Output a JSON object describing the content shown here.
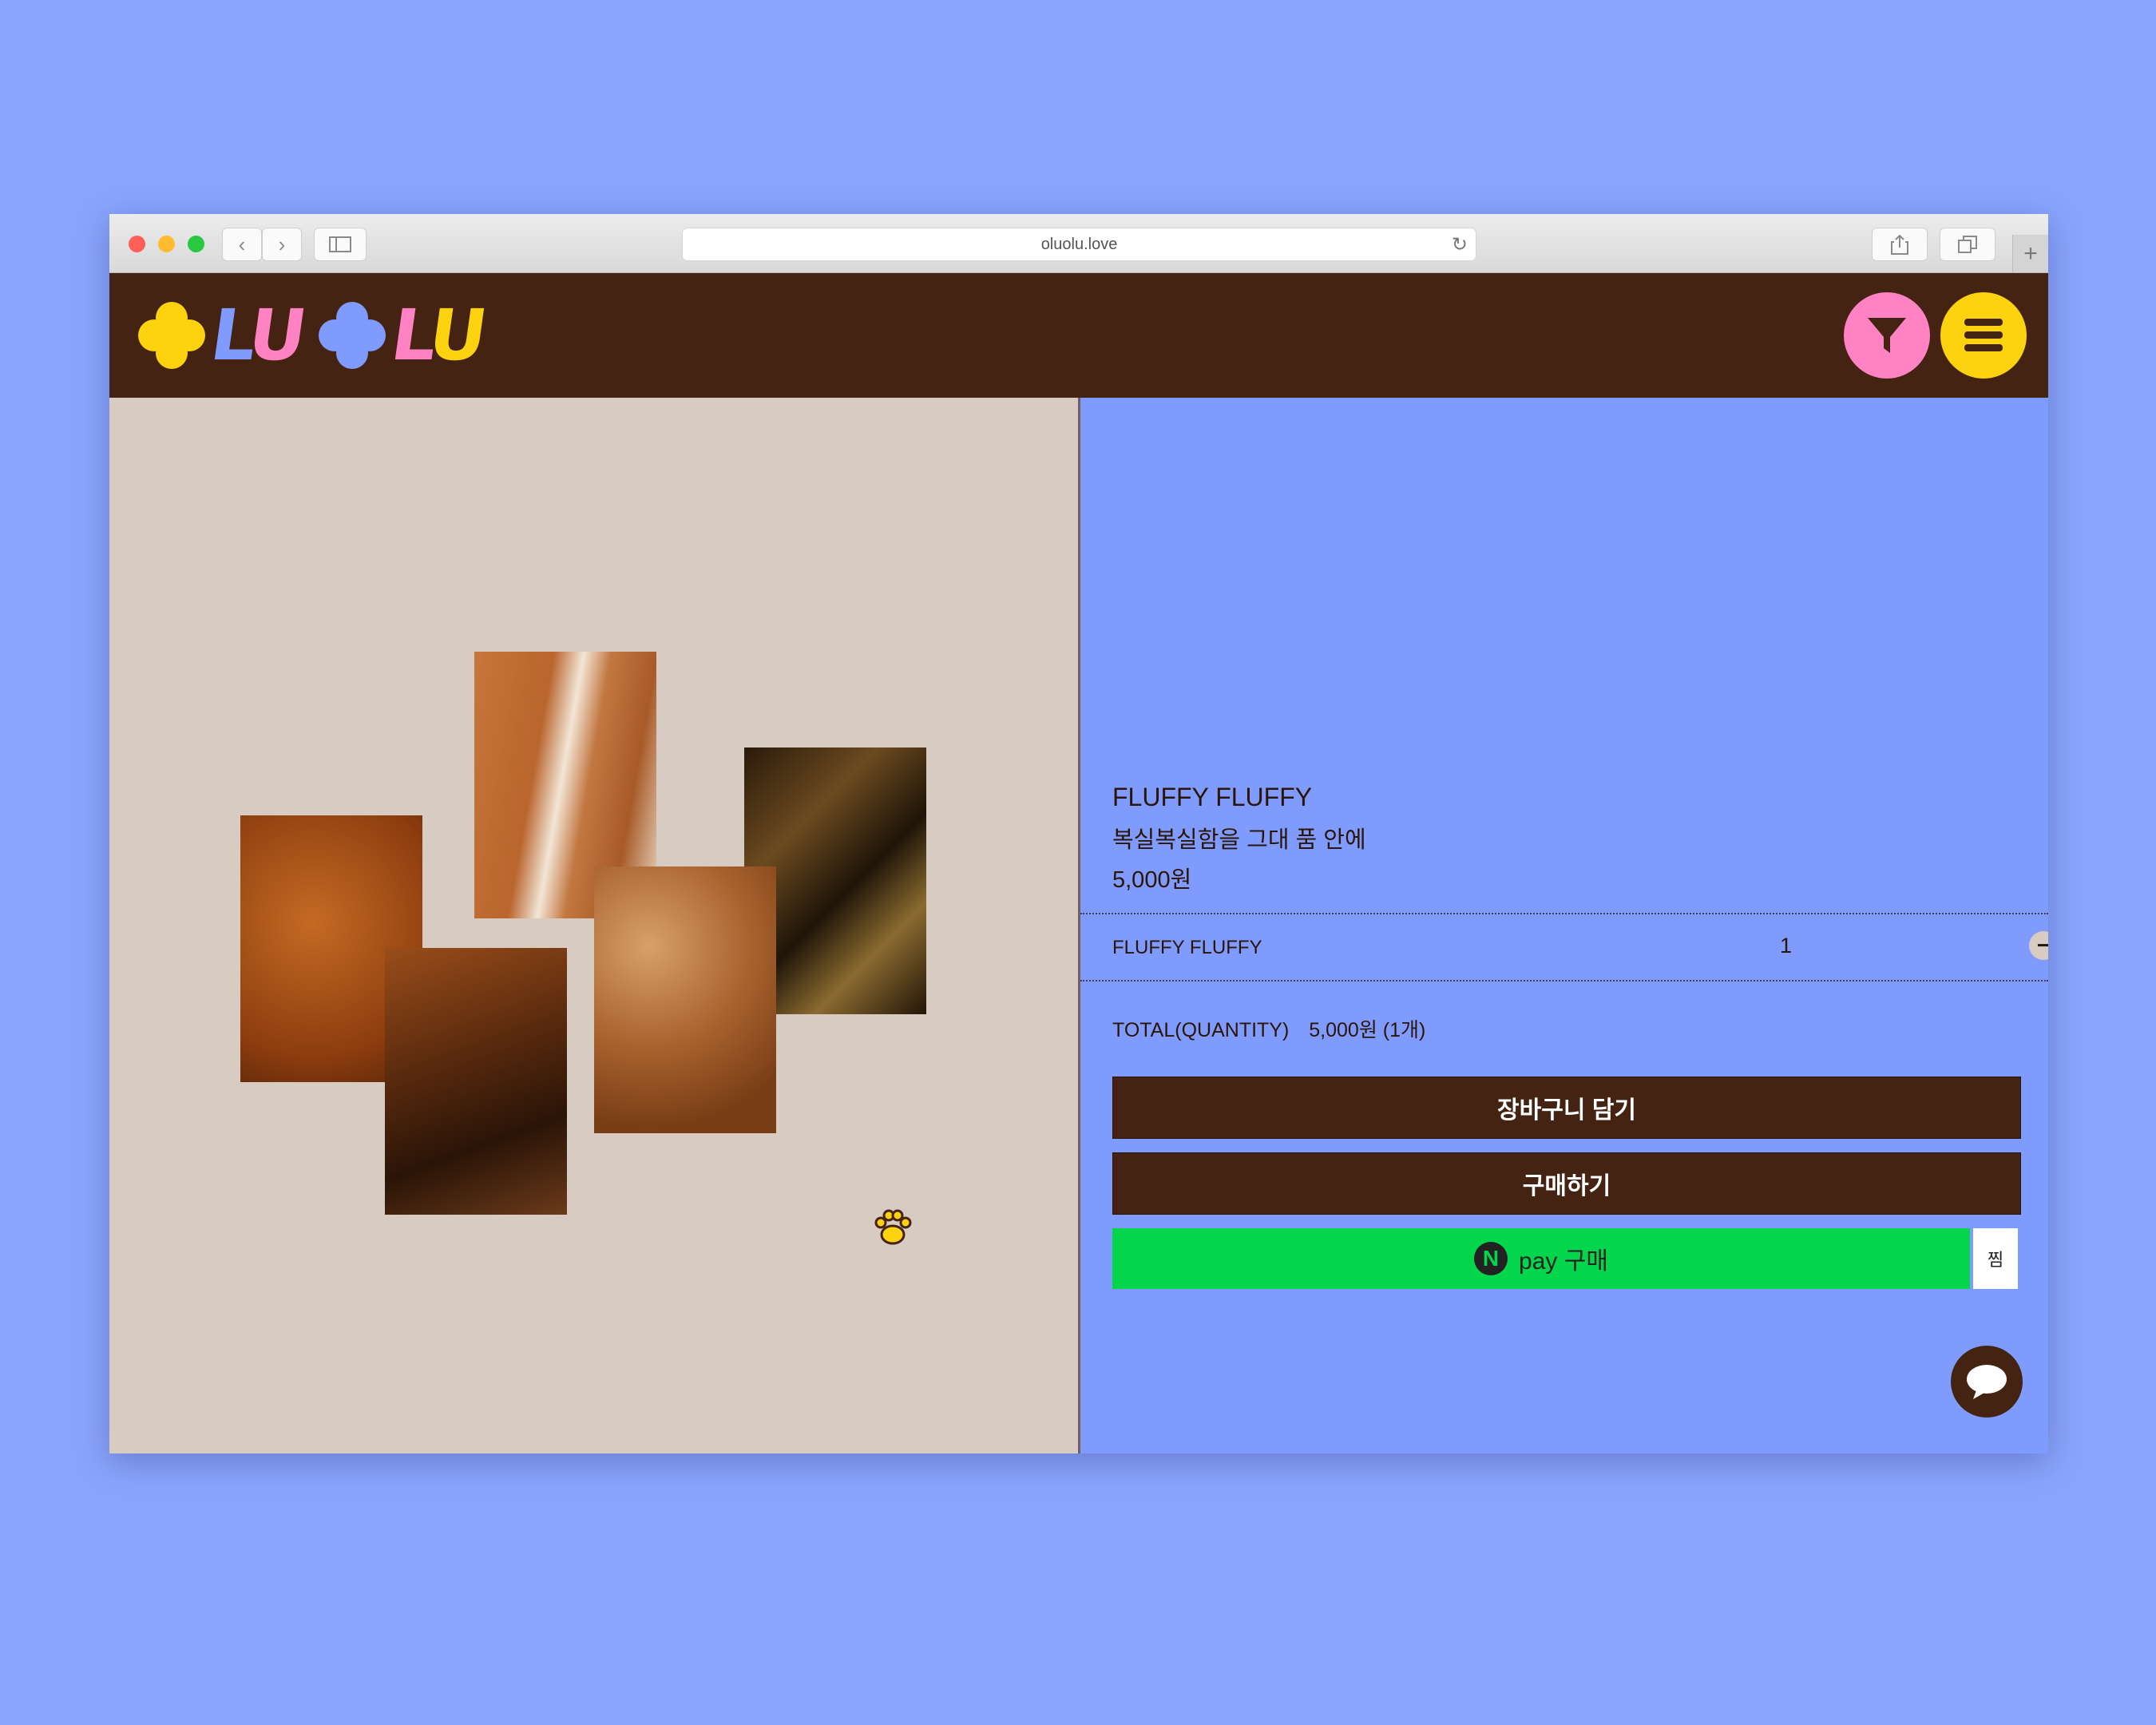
{
  "browser": {
    "url": "oluolu.love",
    "back_icon": "chevron-left-icon",
    "forward_icon": "chevron-right-icon",
    "sidebar_icon": "sidebar-icon",
    "reload_icon": "reload-icon",
    "share_icon": "share-icon",
    "tabs_icon": "tabs-icon",
    "newtab_label": "+"
  },
  "header": {
    "logo_text": "OLU OLU",
    "logo_part1": "LU",
    "logo_part2": "LU",
    "filter_icon": "filter-icon",
    "menu_icon": "menu-icon",
    "colors": {
      "bg": "#452312",
      "yellow": "#fdd20f",
      "pink": "#ff82c2",
      "blue": "#7f9bfd"
    }
  },
  "product": {
    "title": "FLUFFY FLUFFY",
    "subtitle": "복실복실함을 그대 품 안에",
    "price": "5,000원",
    "option_name": "FLUFFY FLUFFY",
    "quantity": "1",
    "minus": "−",
    "plus": "+",
    "total_label": "TOTAL(QUANTITY)",
    "total_value": "5,000원 (1개)"
  },
  "actions": {
    "cart_label": "장바구니 담기",
    "buy_label": "구매하기",
    "npay_logo": "N",
    "npay_label": "pay 구매",
    "wish_label": "찜"
  },
  "gallery": {
    "tiles": [
      "fur-tile-1",
      "fur-tile-2",
      "fur-tile-3",
      "fur-tile-4",
      "fur-tile-5"
    ],
    "paw_icon": "paw-icon"
  },
  "chat": {
    "icon": "chat-icon"
  }
}
